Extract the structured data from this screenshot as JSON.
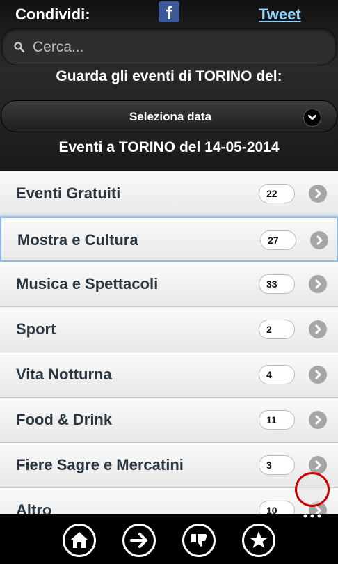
{
  "share": {
    "label": "Condividi:",
    "facebook_glyph": "f",
    "tweet_label": "Tweet",
    "facebook_color": "#3b5998",
    "tweet_color": "#8fd3ff"
  },
  "search": {
    "placeholder": "Cerca..."
  },
  "guide_label": "Guarda gli eventi di TORINO del:",
  "date_select": {
    "label": "Seleziona data"
  },
  "events_title": "Eventi a TORINO del 14-05-2014",
  "categories": [
    {
      "label": "Eventi Gratuiti",
      "count": "22"
    },
    {
      "label": "Mostra e Cultura",
      "count": "27"
    },
    {
      "label": "Musica e Spettacoli",
      "count": "33"
    },
    {
      "label": "Sport",
      "count": "2"
    },
    {
      "label": "Vita Notturna",
      "count": "4"
    },
    {
      "label": "Food & Drink",
      "count": "11"
    },
    {
      "label": "Fiere Sagre e Mercatini",
      "count": "3"
    },
    {
      "label": "Altro",
      "count": "10"
    }
  ],
  "app_bar": {
    "buttons": [
      "home-icon",
      "arrow-right-icon",
      "thumbs-down-icon",
      "star-icon"
    ],
    "more_icon": "more-dots-icon"
  }
}
